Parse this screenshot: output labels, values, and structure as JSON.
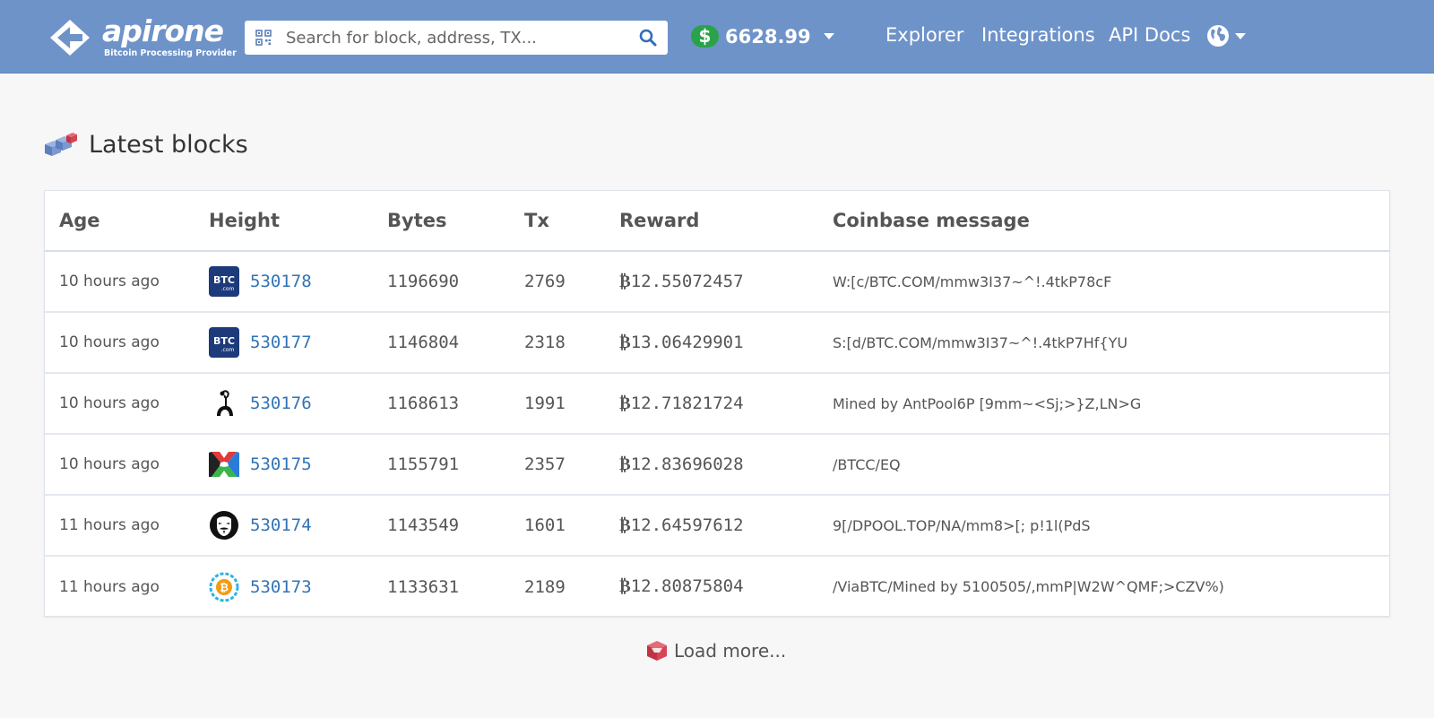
{
  "header": {
    "brand_name": "apirone",
    "brand_tagline": "Bitcoin Processing Provider",
    "search_placeholder": "Search for block, address, TX...",
    "price_symbol": "$",
    "price_value": "6628.99",
    "nav": [
      "Explorer",
      "Integrations",
      "API Docs"
    ]
  },
  "section": {
    "title": "Latest blocks"
  },
  "table": {
    "columns": [
      "Age",
      "Height",
      "Bytes",
      "Tx",
      "Reward",
      "Coinbase message"
    ],
    "rows": [
      {
        "age": "10 hours ago",
        "pool_icon": "btc-com-pool-icon",
        "height": "530178",
        "bytes": "1196690",
        "tx": "2769",
        "reward": "12.55072457",
        "message": "W:[c/BTC.COM/mmw3I37~^!.4tkP78cF"
      },
      {
        "age": "10 hours ago",
        "pool_icon": "btc-com-pool-icon",
        "height": "530177",
        "bytes": "1146804",
        "tx": "2318",
        "reward": "13.06429901",
        "message": "S:[d/BTC.COM/mmw3I37~^!.4tkP7Hf{YU"
      },
      {
        "age": "10 hours ago",
        "pool_icon": "antpool-icon",
        "height": "530176",
        "bytes": "1168613",
        "tx": "1991",
        "reward": "12.71821724",
        "message": "Mined by AntPool6P [9mm~<Sj;>}Z,LN>G"
      },
      {
        "age": "10 hours ago",
        "pool_icon": "btcc-pool-icon",
        "height": "530175",
        "bytes": "1155791",
        "tx": "2357",
        "reward": "12.83696028",
        "message": "/BTCC/EQ"
      },
      {
        "age": "11 hours ago",
        "pool_icon": "dpool-icon",
        "height": "530174",
        "bytes": "1143549",
        "tx": "1601",
        "reward": "12.64597612",
        "message": "9[/DPOOL.TOP/NA/mm8>[; p!1l(PdS"
      },
      {
        "age": "11 hours ago",
        "pool_icon": "viabtc-pool-icon",
        "height": "530173",
        "bytes": "1133631",
        "tx": "2189",
        "reward": "12.80875804",
        "message": "/ViaBTC/Mined by 5100505/,mmP|W2W^QMF;>CZV%)"
      }
    ],
    "currency_symbol": "₿"
  },
  "load_more": "Load more...",
  "colors": {
    "header_bg": "#6e93c9",
    "link": "#3273b6",
    "price_badge": "#2aa24a"
  }
}
